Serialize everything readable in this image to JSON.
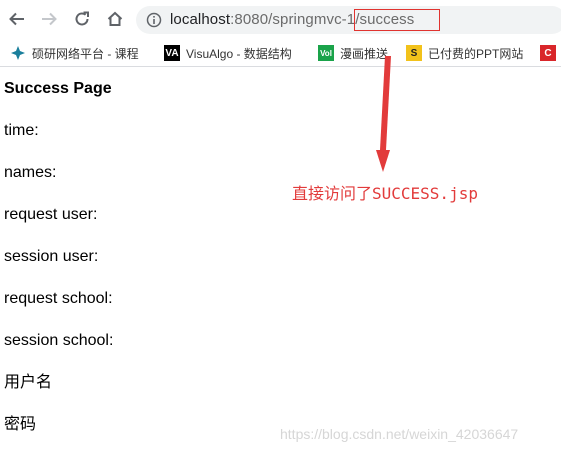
{
  "browser": {
    "url_host": "localhost",
    "url_port_path": ":8080/springmvc-1/success",
    "bookmarks": [
      {
        "label": "硕研网络平台 - 课程",
        "icon": "globe-icon",
        "color": "#1a7f9c"
      },
      {
        "label": "VisuAlgo - 数据结构",
        "icon": "VA",
        "color": "#000000"
      },
      {
        "label": "漫画推送",
        "icon": "Vol",
        "color": "#1aa34a"
      },
      {
        "label": "已付费的PPT网站",
        "icon": "S",
        "color": "#f2c21b"
      },
      {
        "label": "",
        "icon": "C",
        "color": "#d9262a"
      }
    ]
  },
  "page": {
    "heading": "Success Page",
    "lines": [
      "time:",
      "names:",
      "request user:",
      "session user:",
      "request school:",
      "session school:",
      "用户名",
      "密码"
    ]
  },
  "annotation": {
    "text": "直接访问了SUCCESS.jsp",
    "color": "#e23b3b"
  },
  "watermark": "https://blog.csdn.net/weixin_42036647"
}
